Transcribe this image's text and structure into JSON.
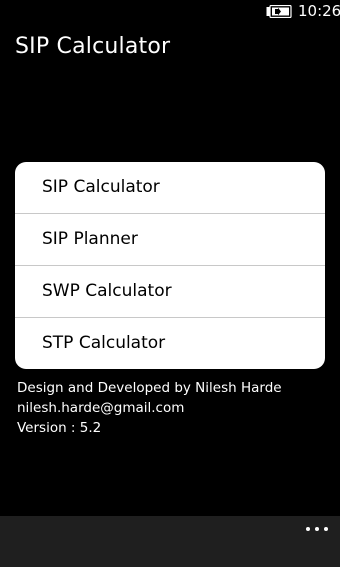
{
  "status_bar": {
    "time": "10:26",
    "battery_icon": "battery-charging-icon"
  },
  "header": {
    "title": "SIP Calculator"
  },
  "menu": {
    "items": [
      {
        "label": "SIP Calculator"
      },
      {
        "label": "SIP Planner"
      },
      {
        "label": "SWP Calculator"
      },
      {
        "label": "STP Calculator"
      }
    ]
  },
  "credits": {
    "developer": "Design and Developed by Nilesh Harde",
    "email": "nilesh.harde@gmail.com",
    "version": "Version : 5.2"
  },
  "app_bar": {
    "more_icon": "more-options-icon"
  },
  "colors": {
    "background": "#000000",
    "card": "#ffffff",
    "divider": "#c8c8c8",
    "app_bar": "#1f1f1f"
  }
}
